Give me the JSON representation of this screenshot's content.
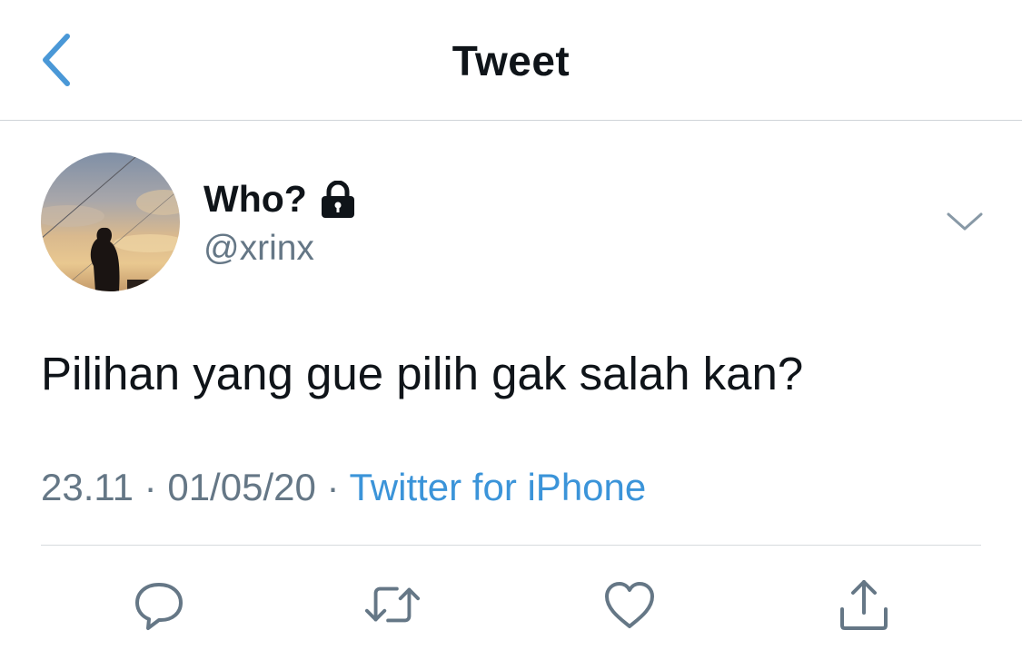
{
  "header": {
    "title": "Tweet",
    "back_icon": "chevron-left-icon"
  },
  "tweet": {
    "display_name": "Who?",
    "protected_icon": "lock-icon",
    "handle": "@xrinx",
    "text": "Pilihan yang gue pilih gak salah kan?",
    "time": "23.11",
    "separator": "·",
    "date": "01/05/20",
    "source": "Twitter for iPhone"
  },
  "actions": {
    "icons": [
      "reply-icon",
      "retweet-icon",
      "like-icon",
      "share-icon"
    ]
  },
  "colors": {
    "accent": "#4a98d7",
    "muted_text": "#657786",
    "icon_gray": "#657786",
    "divider": "#cfd4d8"
  }
}
